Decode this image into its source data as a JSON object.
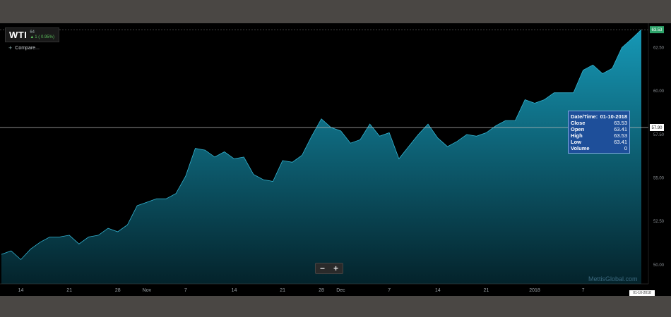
{
  "header": {
    "symbol": "WTI",
    "price": "64",
    "change_arrow": "▲",
    "change_text": "1 ( 0.95%)"
  },
  "compare": {
    "icon": "plus-icon",
    "label": "Compare..."
  },
  "tooltip": {
    "rows": [
      {
        "label": "Date/Time:",
        "value": "01-10-2018"
      },
      {
        "label": "Close",
        "value": "63.53"
      },
      {
        "label": "Open",
        "value": "63.41"
      },
      {
        "label": "High",
        "value": "63.53"
      },
      {
        "label": "Low",
        "value": "63.41"
      },
      {
        "label": "Volume",
        "value": "0"
      }
    ]
  },
  "zoom": {
    "minus": "−",
    "plus": "+"
  },
  "watermark": "MettisGlobal.com",
  "date_badge": "01-10-2018",
  "colors": {
    "area_top": "#1698b6",
    "area_bottom": "#04232b",
    "crosshair": "#bbbbbb",
    "last_badge": "#2ea36a"
  },
  "chart_data": {
    "type": "area",
    "title": "",
    "xlabel": "",
    "ylabel": "",
    "ylim": [
      48.9,
      63.9
    ],
    "y_ticks": [
      "62.50",
      "60.00",
      "57.50",
      "55.00",
      "52.50",
      "50.00"
    ],
    "y_tick_values": [
      62.5,
      60,
      57.5,
      55,
      52.5,
      50
    ],
    "x_ticks": [
      {
        "label": "14",
        "i": 2
      },
      {
        "label": "21",
        "i": 7
      },
      {
        "label": "28",
        "i": 12
      },
      {
        "label": "Nov",
        "i": 15
      },
      {
        "label": "7",
        "i": 19
      },
      {
        "label": "14",
        "i": 24
      },
      {
        "label": "21",
        "i": 29
      },
      {
        "label": "28",
        "i": 33
      },
      {
        "label": "Dec",
        "i": 35
      },
      {
        "label": "7",
        "i": 40
      },
      {
        "label": "14",
        "i": 45
      },
      {
        "label": "21",
        "i": 50
      },
      {
        "label": "2018",
        "i": 55
      },
      {
        "label": "7",
        "i": 60
      }
    ],
    "last_value": "63.53",
    "crosshair_value": "57.90",
    "crosshair_y": 57.9,
    "series": [
      {
        "values": [
          50.6,
          50.8,
          50.3,
          50.9,
          51.3,
          51.6,
          51.6,
          51.7,
          51.2,
          51.6,
          51.7,
          52.1,
          51.9,
          52.3,
          53.4,
          53.6,
          53.8,
          53.8,
          54.1,
          55.1,
          56.7,
          56.6,
          56.2,
          56.5,
          56.1,
          56.2,
          55.2,
          54.9,
          54.8,
          56.0,
          55.9,
          56.3,
          57.4,
          58.4,
          57.9,
          57.7,
          57.0,
          57.2,
          58.1,
          57.4,
          57.6,
          56.1,
          56.8,
          57.5,
          58.1,
          57.3,
          56.8,
          57.1,
          57.5,
          57.4,
          57.6,
          58.0,
          58.3,
          58.3,
          59.5,
          59.3,
          59.5,
          59.9,
          59.9,
          59.9,
          61.2,
          61.5,
          61.0,
          61.3,
          62.5,
          63.0,
          63.53
        ]
      }
    ]
  }
}
